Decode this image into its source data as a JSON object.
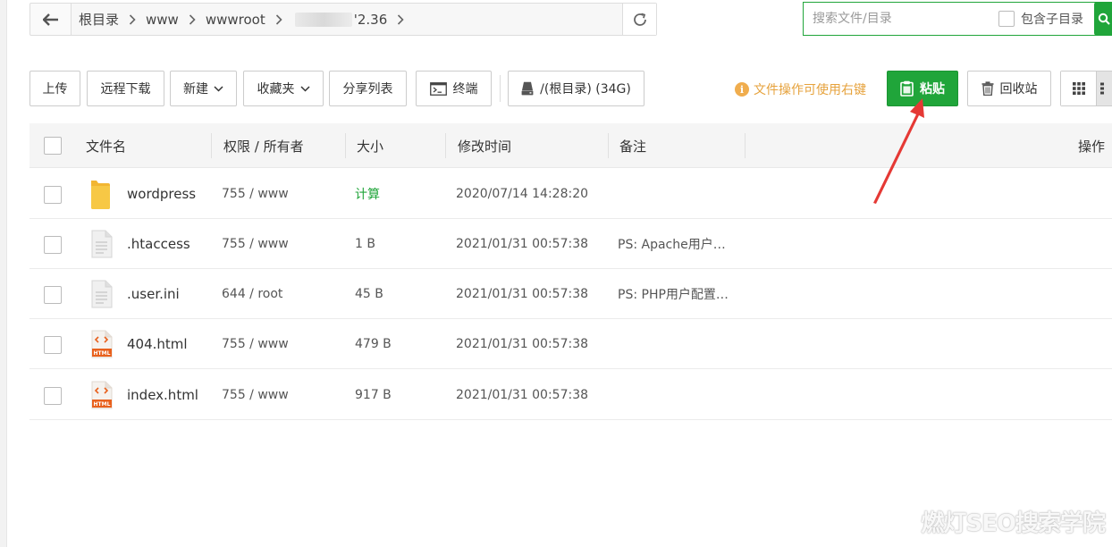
{
  "path_bar": {
    "crumbs": [
      "根目录",
      "www",
      "wwwroot",
      "'2.36"
    ]
  },
  "search": {
    "placeholder": "搜索文件/目录",
    "value": "",
    "include_subdirs_label": "包含子目录"
  },
  "toolbar": {
    "upload": "上传",
    "remote_download": "远程下载",
    "new": "新建",
    "favorites": "收藏夹",
    "share_list": "分享列表",
    "terminal": "终端",
    "disk": "/(根目录) (34G)",
    "tip": "文件操作可使用右键",
    "paste": "粘贴",
    "recycle_bin": "回收站"
  },
  "table": {
    "headers": {
      "name": "文件名",
      "perm_owner": "权限 / 所有者",
      "size": "大小",
      "mtime": "修改时间",
      "remark": "备注",
      "ops": "操作"
    },
    "rows": [
      {
        "icon": "folder-icon",
        "name": "wordpress",
        "perm": "755 / www",
        "size": "计算",
        "mtime": "2020/07/14 14:28:20",
        "remark": ""
      },
      {
        "icon": "file-icon",
        "name": ".htaccess",
        "perm": "755 / www",
        "size": "1 B",
        "mtime": "2021/01/31 00:57:38",
        "remark": "PS: Apache用户…"
      },
      {
        "icon": "file-icon",
        "name": ".user.ini",
        "perm": "644 / root",
        "size": "45 B",
        "mtime": "2021/01/31 00:57:38",
        "remark": "PS: PHP用户配置…"
      },
      {
        "icon": "html-file-icon",
        "name": "404.html",
        "perm": "755 / www",
        "size": "479 B",
        "mtime": "2021/01/31 00:57:38",
        "remark": ""
      },
      {
        "icon": "html-file-icon",
        "name": "index.html",
        "perm": "755 / www",
        "size": "917 B",
        "mtime": "2021/01/31 00:57:38",
        "remark": ""
      }
    ]
  },
  "watermark": "燃灯SEO搜索学院",
  "colors": {
    "accent_green": "#20a53a",
    "tip_orange": "#e6a23c",
    "arrow_red": "#e53935",
    "folder_yellow": "#f7c845"
  }
}
